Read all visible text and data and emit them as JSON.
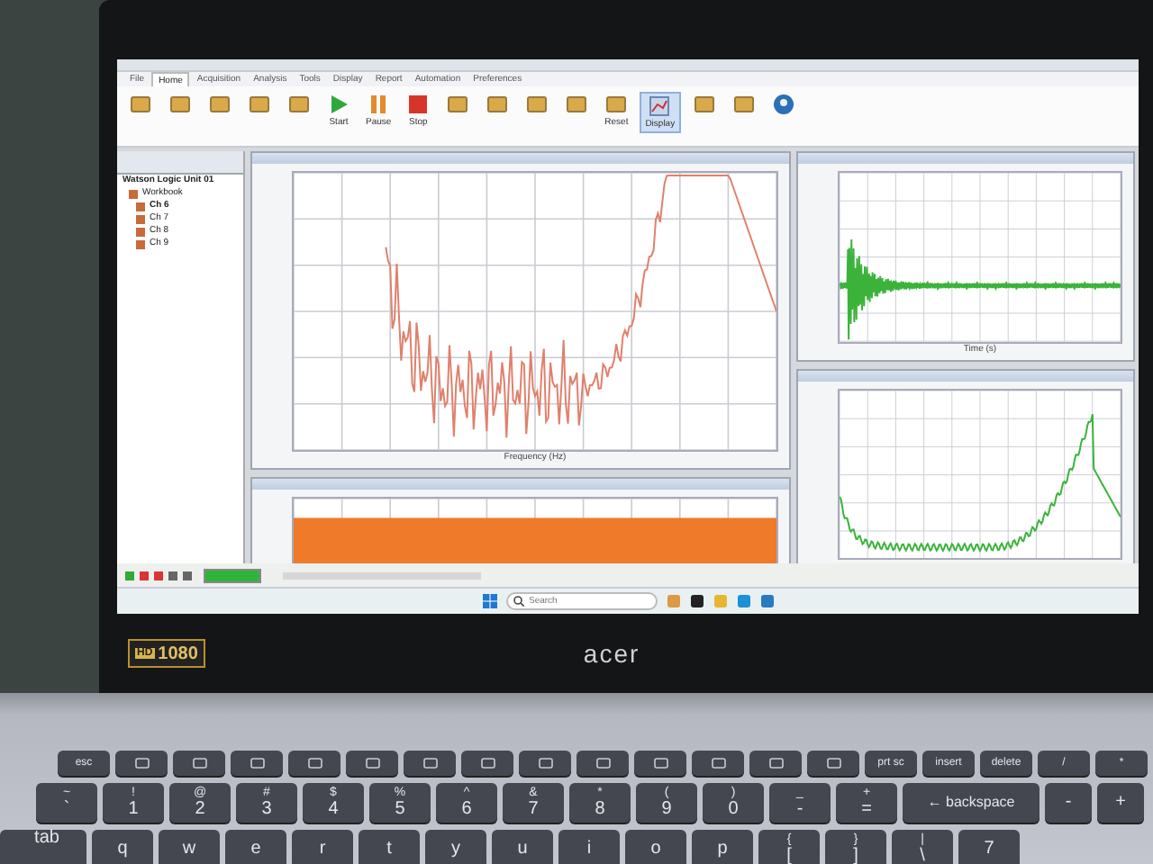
{
  "app": {
    "ribbon_tabs": [
      {
        "label": "File",
        "selected": false
      },
      {
        "label": "Home",
        "selected": true
      },
      {
        "label": "Acquisition",
        "selected": false
      },
      {
        "label": "Analysis",
        "selected": false
      },
      {
        "label": "Tools",
        "selected": false
      },
      {
        "label": "Display",
        "selected": false
      },
      {
        "label": "Report",
        "selected": false
      },
      {
        "label": "Automation",
        "selected": false
      },
      {
        "label": "Preferences",
        "selected": false
      }
    ],
    "ribbon_buttons": [
      {
        "kind": "generic"
      },
      {
        "kind": "generic"
      },
      {
        "kind": "generic"
      },
      {
        "kind": "generic"
      },
      {
        "kind": "generic"
      },
      {
        "label": "Start",
        "kind": "play"
      },
      {
        "label": "Pause",
        "kind": "pause"
      },
      {
        "label": "Stop",
        "kind": "stop"
      },
      {
        "kind": "generic"
      },
      {
        "kind": "generic"
      },
      {
        "kind": "generic"
      },
      {
        "kind": "generic"
      },
      {
        "label": "Reset",
        "kind": "generic"
      },
      {
        "label": "Display",
        "kind": "display"
      },
      {
        "kind": "generic"
      },
      {
        "kind": "generic"
      },
      {
        "kind": "profile"
      }
    ],
    "tree": {
      "title": "Watson Logic Unit 01",
      "items": [
        {
          "label": "Workbook",
          "children": [
            {
              "label": "Ch 6"
            },
            {
              "label": "Ch 7"
            },
            {
              "label": "Ch 8"
            },
            {
              "label": "Ch 9"
            }
          ]
        }
      ]
    },
    "panels": [
      {
        "kind": "spectrum",
        "color": "#e0806c",
        "xlabel": "Frequency (Hz)"
      },
      {
        "kind": "bars",
        "color": "#ef7a2a"
      },
      {
        "kind": "decay",
        "color": "#3bb33b",
        "xlabel": "Time (s)"
      },
      {
        "kind": "spectrum-rise",
        "color": "#3bb33b"
      }
    ],
    "status": {
      "level": 1
    }
  },
  "taskbar": {
    "search": {
      "placeholder": "Search"
    }
  },
  "laptop": {
    "brand": "acer",
    "sticker": {
      "badge": "HD",
      "resolution": "1080"
    }
  },
  "keyboard": {
    "function_keys": [
      {
        "label": "esc"
      },
      {
        "kind": "fn"
      },
      {
        "kind": "fn"
      },
      {
        "kind": "fn"
      },
      {
        "kind": "fn"
      },
      {
        "kind": "fn"
      },
      {
        "kind": "fn"
      },
      {
        "kind": "fn"
      },
      {
        "kind": "fn"
      },
      {
        "kind": "fn"
      },
      {
        "kind": "fn"
      },
      {
        "kind": "fn"
      },
      {
        "kind": "fn"
      },
      {
        "kind": "fn"
      },
      {
        "label": "prt sc"
      },
      {
        "label": "insert"
      },
      {
        "label": "delete"
      },
      {
        "label": "/"
      },
      {
        "label": "*"
      }
    ],
    "number_keys": [
      {
        "label": "`",
        "shift": "~"
      },
      {
        "label": "1",
        "shift": "!"
      },
      {
        "label": "2",
        "shift": "@"
      },
      {
        "label": "3",
        "shift": "#"
      },
      {
        "label": "4",
        "shift": "$"
      },
      {
        "label": "5",
        "shift": "%"
      },
      {
        "label": "6",
        "shift": "^"
      },
      {
        "label": "7",
        "shift": "&"
      },
      {
        "label": "8",
        "shift": "*"
      },
      {
        "label": "9",
        "shift": "("
      },
      {
        "label": "0",
        "shift": ")"
      },
      {
        "label": "-",
        "shift": "_"
      },
      {
        "label": "=",
        "shift": "+"
      },
      {
        "label": "← backspace",
        "kind": "wide"
      },
      {
        "label": "-"
      },
      {
        "label": "+"
      }
    ],
    "letter_keys": [
      {
        "label": "tab",
        "kind": "wide-left"
      },
      {
        "label": "q"
      },
      {
        "label": "w"
      },
      {
        "label": "e"
      },
      {
        "label": "r"
      },
      {
        "label": "t"
      },
      {
        "label": "y"
      },
      {
        "label": "u"
      },
      {
        "label": "i"
      },
      {
        "label": "o"
      },
      {
        "label": "p"
      },
      {
        "label": "[",
        "shift": "{"
      },
      {
        "label": "]",
        "shift": "}"
      },
      {
        "label": "\\",
        "shift": "|"
      },
      {
        "label": "7"
      }
    ]
  }
}
